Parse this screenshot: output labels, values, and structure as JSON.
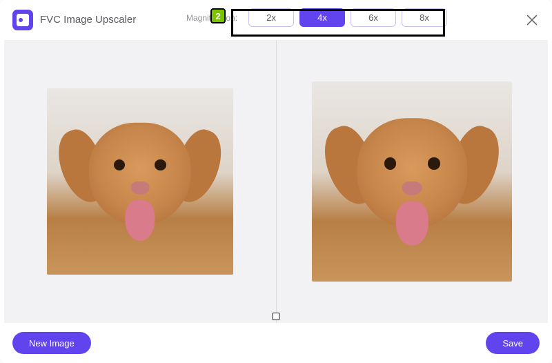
{
  "app": {
    "title": "FVC Image Upscaler"
  },
  "header": {
    "magnification_label": "Magnification:",
    "options": [
      {
        "label": "2x",
        "active": false
      },
      {
        "label": "4x",
        "active": true
      },
      {
        "label": "6x",
        "active": false
      },
      {
        "label": "8x",
        "active": false
      }
    ]
  },
  "annotation": {
    "step": "2"
  },
  "footer": {
    "new_image_label": "New Image",
    "save_label": "Save"
  }
}
